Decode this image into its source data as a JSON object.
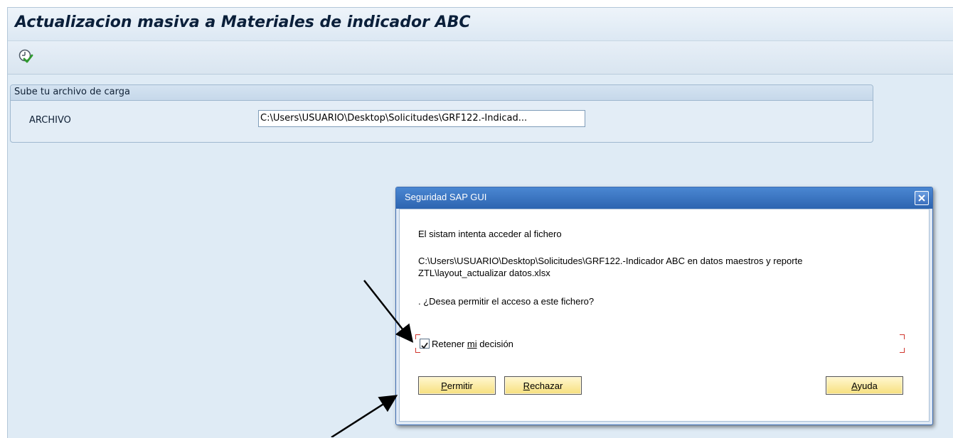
{
  "app": {
    "title": "Actualizacion masiva a Materiales de indicador ABC"
  },
  "toolbar": {
    "execute_icon": "execute-clock-check-icon"
  },
  "upload_group": {
    "title": "Sube tu archivo de carga",
    "field_label": "ARCHIVO",
    "field_value": "C:\\Users\\USUARIO\\Desktop\\Solicitudes\\GRF122.-Indicad..."
  },
  "dialog": {
    "title": "Seguridad SAP GUI",
    "message": "El sistam intenta acceder al fichero",
    "path_line1": "C:\\Users\\USUARIO\\Desktop\\Solicitudes\\GRF122.-Indicador ABC en datos maestros y reporte",
    "path_line2": "ZTL\\layout_actualizar datos.xlsx",
    "question": ". ¿Desea permitir el acceso a este fichero?",
    "retain_label_pre": "Retener ",
    "retain_label_mnemonic": "mi",
    "retain_label_post": " decisión",
    "retain_checked": true,
    "buttons": {
      "allow_mnemonic": "P",
      "allow_rest": "ermitir",
      "reject_mnemonic": "R",
      "reject_rest": "echazar",
      "help_mnemonic": "A",
      "help_rest": "yuda"
    },
    "colors": {
      "titlebar": "#2d64b0",
      "button": "#f7e07e",
      "focus_corners": "#d0342c"
    }
  }
}
